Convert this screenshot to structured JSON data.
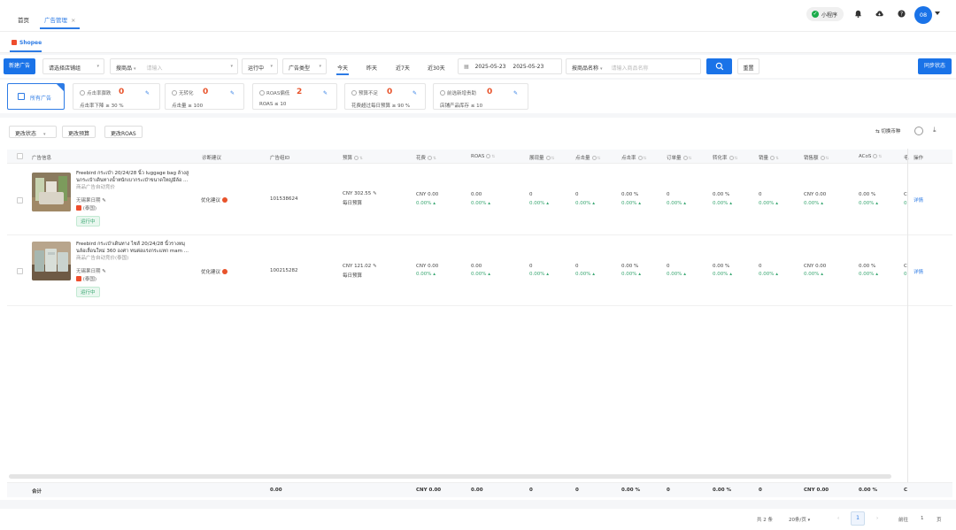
{
  "top_tabs": [
    {
      "label": "首页"
    },
    {
      "label": "广告管理",
      "active": true
    }
  ],
  "top_right": {
    "mini_label": "小程序",
    "avatar_text": "08"
  },
  "platform": {
    "label": "Shopee"
  },
  "filter": {
    "new_ad": "新建广告",
    "shop_select": "请选择店铺组",
    "search_type": "搜商品",
    "search_placeholder": "请输入",
    "status_select": "运行中",
    "ad_type_select": "广告类型",
    "date_tabs": [
      "今天",
      "昨天",
      "近7天",
      "近30天"
    ],
    "date_start": "2025-05-23",
    "date_end": "2025-05-23",
    "product_name_select": "按商品名称",
    "product_name_placeholder": "请输入商品名称",
    "reset": "重置",
    "sync": "同步状态"
  },
  "summary_cards": [
    {
      "label": "所有广告"
    },
    {
      "label": "点击率骤跌",
      "count": "0",
      "sub": "点击率下降 ≥ 30 %"
    },
    {
      "label": "无转化",
      "count": "0",
      "sub": "点击量 ≥ 100"
    },
    {
      "label": "ROAS偏低",
      "count": "2",
      "sub": "ROAS ≤ 10"
    },
    {
      "label": "预算不足",
      "count": "0",
      "sub": "花费超过每日预算 ≥ 90 %"
    },
    {
      "label": "前选新增贵助",
      "count": "0",
      "sub": "店铺产品库存 ≤ 10"
    }
  ],
  "table_toolbar": {
    "change_status": "更改状态",
    "change_budget": "更改预算",
    "change_roas": "更改ROAS",
    "switch_currency": "切换币种"
  },
  "columns": [
    "广告信息",
    "诊断建议",
    "广告组ID",
    "预算",
    "花费",
    "ROAS",
    "展现量",
    "点击量",
    "点击率",
    "订单量",
    "转化率",
    "销量",
    "销售额",
    "ACoS",
    "毛",
    "操作"
  ],
  "rows": [
    {
      "title_l1": "Freebird กระเป๋า 20/24/28 นิ้ว luggage bag ล้างสู",
      "title_l2": "นกระเป๋าเดินทางน้ำหนักเบากระเป๋าขนาดใหญ่มีล้อ ...",
      "title_l3": "商品广告自动竞价",
      "shop": "无锡果日期",
      "region": "(泰国)",
      "status": "运行中",
      "diagnosis": "优化建议",
      "group_id": "101538624",
      "budget": "CNY 302.55",
      "budget_type": "每日预算",
      "spend": "CNY 0.00",
      "spend_chg": "0.00%",
      "roas": "0.00",
      "roas_chg": "0.00%",
      "impressions": "0",
      "impressions_chg": "0.00%",
      "clicks": "0",
      "clicks_chg": "0.00%",
      "ctr": "0.00 %",
      "ctr_chg": "0.00%",
      "orders": "0",
      "orders_chg": "0.00%",
      "cvr": "0.00 %",
      "cvr_chg": "0.00%",
      "sales": "0",
      "sales_chg": "0.00%",
      "revenue": "CNY 0.00",
      "revenue_chg": "0.00%",
      "acos": "0.00 %",
      "acos_chg": "0.00%",
      "gross": "C",
      "gross_chg": "0",
      "action": "详情"
    },
    {
      "title_l1": "Freebird กระเป๋าเดินทาง ไซส์ 20/24/28 นิ้วรางหมุ",
      "title_l2": "นล้อเลื่อนใหม่ 360 องศา ทนต่อแรงกระแทก mam ...",
      "title_l3": "商品广告自动竞价(泰国)",
      "shop": "无锡果日期",
      "region": "(泰国)",
      "status": "运行中",
      "diagnosis": "优化建议",
      "group_id": "100215282",
      "budget": "CNY 121.02",
      "budget_type": "每日预算",
      "spend": "CNY 0.00",
      "spend_chg": "0.00%",
      "roas": "0.00",
      "roas_chg": "0.00%",
      "impressions": "0",
      "impressions_chg": "0.00%",
      "clicks": "0",
      "clicks_chg": "0.00%",
      "ctr": "0.00 %",
      "ctr_chg": "0.00%",
      "orders": "0",
      "orders_chg": "0.00%",
      "cvr": "0.00 %",
      "cvr_chg": "0.00%",
      "sales": "0",
      "sales_chg": "0.00%",
      "revenue": "CNY 0.00",
      "revenue_chg": "0.00%",
      "acos": "0.00 %",
      "acos_chg": "0.00%",
      "gross": "C",
      "gross_chg": "0",
      "action": "详情"
    }
  ],
  "totals": {
    "label": "合计",
    "group_id": "0.00",
    "spend": "CNY 0.00",
    "roas": "0.00",
    "impressions": "0",
    "clicks": "0",
    "ctr": "0.00 %",
    "orders": "0",
    "cvr": "0.00 %",
    "sales": "0",
    "revenue": "CNY 0.00",
    "acos": "0.00 %",
    "gross": "C"
  },
  "pagination": {
    "total": "共 2 条",
    "page_size": "20条/页",
    "current": "1",
    "goto": "前往",
    "goto_value": "1",
    "goto_suffix": "页"
  },
  "colors": {
    "primary": "#1a73e8",
    "danger": "#e8532b",
    "success": "#3aa772"
  }
}
